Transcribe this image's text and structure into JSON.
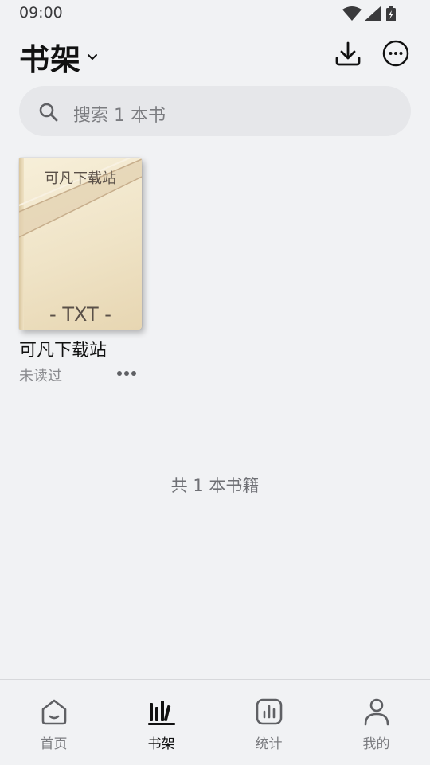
{
  "status_bar": {
    "time": "09:00",
    "icons": [
      "wifi-icon",
      "signal-icon",
      "battery-charging-icon"
    ]
  },
  "header": {
    "title": "书架",
    "title_menu_icon": "chevron-down-icon",
    "actions": [
      "download-icon",
      "more-circle-icon"
    ]
  },
  "search": {
    "icon": "search-icon",
    "placeholder": "搜索 1 本书"
  },
  "books": [
    {
      "cover_title": "可凡下载站",
      "cover_format": "- TXT -",
      "name": "可凡下载站",
      "status": "未读过",
      "more_icon": "more-horizontal-icon"
    }
  ],
  "footer_count": "共 1 本书籍",
  "nav": {
    "items": [
      {
        "label": "首页",
        "icon": "home-icon",
        "active": false
      },
      {
        "label": "书架",
        "icon": "bookshelf-icon",
        "active": true
      },
      {
        "label": "统计",
        "icon": "stats-icon",
        "active": false
      },
      {
        "label": "我的",
        "icon": "person-icon",
        "active": false
      }
    ]
  },
  "colors": {
    "background": "#f1f2f4",
    "search_background": "#e6e7ea",
    "cover": "#efe3c6",
    "active_text": "#111111",
    "inactive_text": "#7b7c80"
  }
}
